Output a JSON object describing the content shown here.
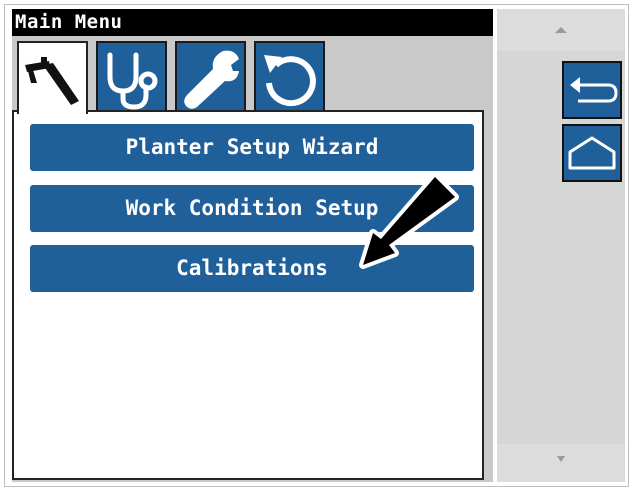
{
  "title": "Main Menu",
  "tabs": [
    {
      "icon": "caliper-icon",
      "active": true
    },
    {
      "icon": "stethoscope-icon",
      "active": false
    },
    {
      "icon": "wrench-icon",
      "active": false
    },
    {
      "icon": "reset-icon",
      "active": false
    }
  ],
  "menu": {
    "items": [
      {
        "label": "Planter Setup Wizard"
      },
      {
        "label": "Work Condition Setup"
      },
      {
        "label": "Calibrations"
      }
    ]
  },
  "side_buttons": [
    {
      "icon": "back-arrow-icon"
    },
    {
      "icon": "home-icon"
    }
  ],
  "colors": {
    "accent": "#1f5f9a",
    "title_bar": "#000000",
    "background": "#c9c9c9"
  }
}
